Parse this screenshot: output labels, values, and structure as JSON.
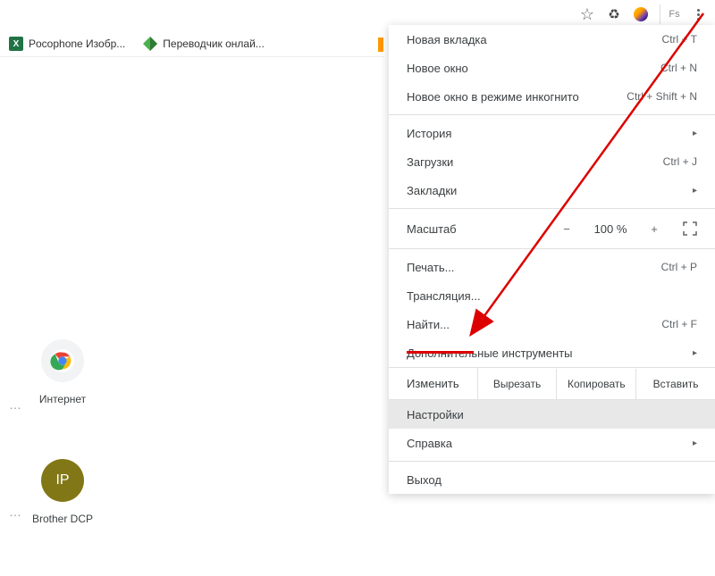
{
  "toolbar": {
    "fs_label": "Fs"
  },
  "bookmarks": [
    {
      "label": "Pocophone Изобр...",
      "icon": "excel"
    },
    {
      "label": "Переводчик онлай...",
      "icon": "translate"
    }
  ],
  "menu": {
    "new_tab": {
      "label": "Новая вкладка",
      "shortcut": "Ctrl + T"
    },
    "new_window": {
      "label": "Новое окно",
      "shortcut": "Ctrl + N"
    },
    "incognito": {
      "label": "Новое окно в режиме инкогнито",
      "shortcut": "Ctrl + Shift + N"
    },
    "history": {
      "label": "История"
    },
    "downloads": {
      "label": "Загрузки",
      "shortcut": "Ctrl + J"
    },
    "bookmarks": {
      "label": "Закладки"
    },
    "zoom": {
      "label": "Масштаб",
      "minus": "−",
      "value": "100 %",
      "plus": "+"
    },
    "print": {
      "label": "Печать...",
      "shortcut": "Ctrl + P"
    },
    "cast": {
      "label": "Трансляция..."
    },
    "find": {
      "label": "Найти...",
      "shortcut": "Ctrl + F"
    },
    "more_tools": {
      "label": "Дополнительные инструменты"
    },
    "edit": {
      "label": "Изменить",
      "cut": "Вырезать",
      "copy": "Копировать",
      "paste": "Вставить"
    },
    "settings": {
      "label": "Настройки"
    },
    "help": {
      "label": "Справка"
    },
    "exit": {
      "label": "Выход"
    }
  },
  "shortcuts": [
    {
      "label": "Интернет"
    },
    {
      "label": "Brother DCP",
      "badge": "IP"
    }
  ]
}
